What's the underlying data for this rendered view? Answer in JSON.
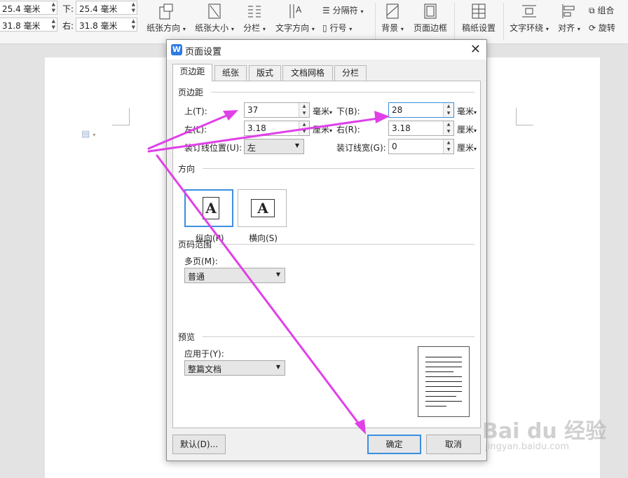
{
  "ribbon": {
    "top_value": "25.4 毫米",
    "bottom_label": "下:",
    "bottom_value": "25.4 毫米",
    "left_value": "31.8 毫米",
    "right_label": "右:",
    "right_value": "31.8 毫米",
    "paper_orientation": "纸张方向",
    "paper_size": "纸张大小",
    "columns": "分栏",
    "text_direction": "文字方向",
    "separator": "分隔符",
    "line_number": "行号",
    "background": "背景",
    "page_border": "页面边框",
    "manuscript": "稿纸设置",
    "text_wrap": "文字环绕",
    "align": "对齐",
    "group": "组合",
    "rotate": "旋转"
  },
  "dialog": {
    "logo": "W",
    "title": "页面设置",
    "tabs": [
      "页边距",
      "纸张",
      "版式",
      "文档网格",
      "分栏"
    ],
    "margins_group": "页边距",
    "top_label": "上(T):",
    "top_value": "37",
    "top_unit": "毫米",
    "bottom_label": "下(B):",
    "bottom_value": "28",
    "bottom_unit": "毫米",
    "left_label": "左(L):",
    "left_value": "3.18",
    "left_unit": "厘米",
    "right_label": "右(R):",
    "right_value": "3.18",
    "right_unit": "厘米",
    "gutter_pos_label": "装订线位置(U):",
    "gutter_pos_value": "左",
    "gutter_width_label": "装订线宽(G):",
    "gutter_width_value": "0",
    "gutter_width_unit": "厘米",
    "orientation_group": "方向",
    "portrait_label": "纵向(P)",
    "landscape_label": "横向(S)",
    "paper_glyph": "A",
    "page_range_group": "页码范围",
    "multi_page_label": "多页(M):",
    "multi_page_value": "普通",
    "preview_group": "预览",
    "apply_to_label": "应用于(Y):",
    "apply_to_value": "整篇文档",
    "default_button": "默认(D)...",
    "ok_button": "确定",
    "cancel_button": "取消"
  },
  "watermark": {
    "brand": "Bai du 经验",
    "url": "jingyan.baidu.com"
  },
  "colors": {
    "accent": "#3b8fe0",
    "annotation_arrow": "#e040e8"
  }
}
